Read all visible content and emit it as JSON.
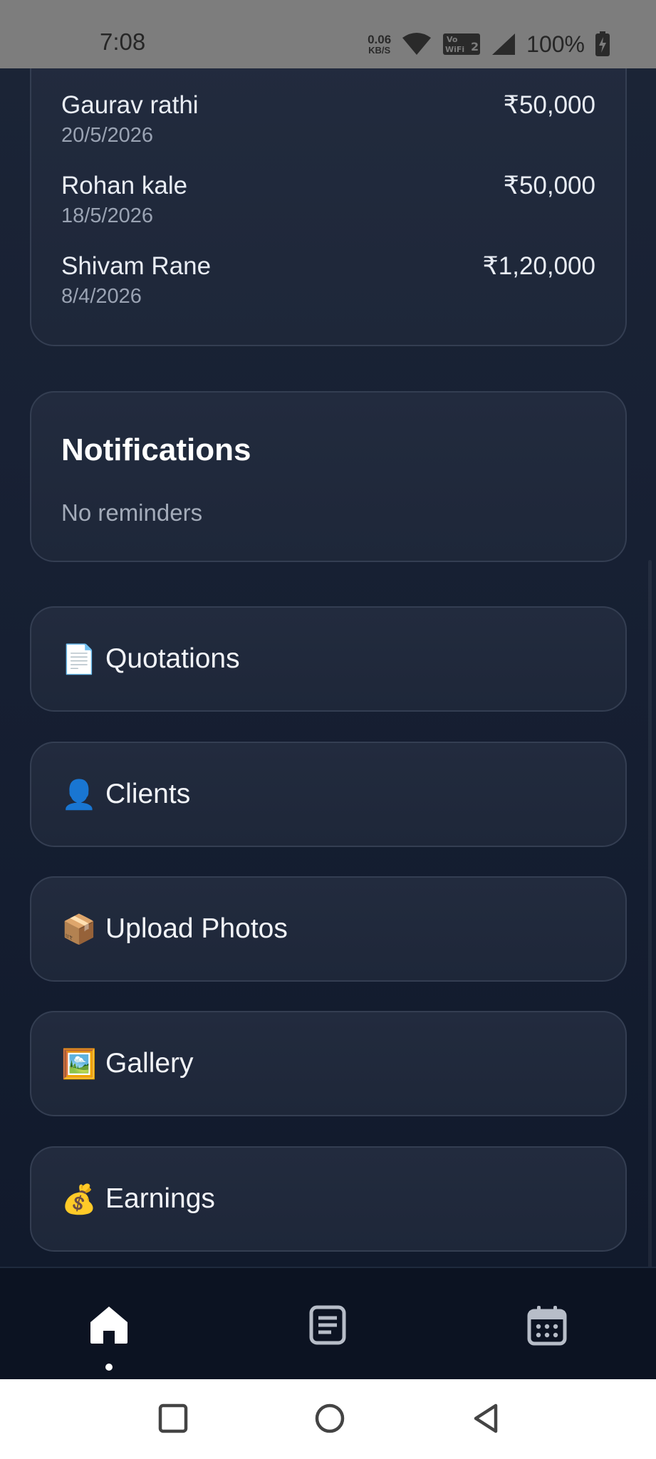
{
  "status_bar": {
    "time": "7:08",
    "net_speed_value": "0.06",
    "net_speed_unit": "KB/S",
    "wifi_badge": "Vo WiFi 2",
    "battery": "100%"
  },
  "payments": [
    {
      "name": "Gaurav rathi",
      "date": "20/5/2026",
      "amount": "₹50,000"
    },
    {
      "name": "Rohan kale",
      "date": "18/5/2026",
      "amount": "₹50,000"
    },
    {
      "name": "Shivam Rane",
      "date": "8/4/2026",
      "amount": "₹1,20,000"
    }
  ],
  "notifications": {
    "title": "Notifications",
    "empty_text": "No reminders"
  },
  "menu": [
    {
      "emoji": "📄",
      "label": "Quotations",
      "icon": "document-icon"
    },
    {
      "emoji": "👤",
      "label": "Clients",
      "icon": "user-icon"
    },
    {
      "emoji": "📦",
      "label": "Upload Photos",
      "icon": "package-icon"
    },
    {
      "emoji": "🖼️",
      "label": "Gallery",
      "icon": "picture-icon"
    },
    {
      "emoji": "💰",
      "label": "Earnings",
      "icon": "money-bag-icon"
    }
  ],
  "bottom_nav": {
    "items": [
      "home-icon",
      "list-icon",
      "calendar-icon"
    ],
    "active": "home-icon"
  },
  "colors": {
    "background": "#101a2c",
    "card": "#222b3e",
    "card_border": "#343e52",
    "nav_bg": "#0c1322",
    "status_bar": "#7d7d7d"
  }
}
